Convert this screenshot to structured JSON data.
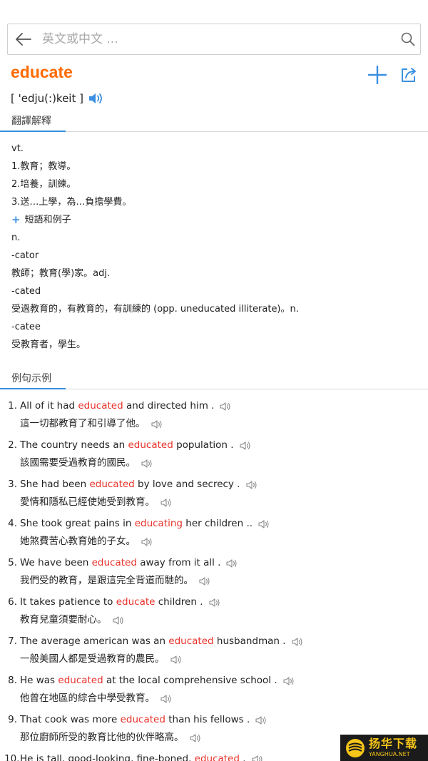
{
  "search": {
    "placeholder": "英文或中文 ..."
  },
  "word": {
    "headword": "educate",
    "phonetic": "[ 'edju(:)keit ]"
  },
  "sections": {
    "translation": "翻譯解釋",
    "examples": "例句示例"
  },
  "definitions": [
    "vt.",
    "1.教育；教導。",
    "2.培養，訓練。",
    "3.送…上學，為…負擔學費。",
    "n.",
    "-cator",
    "教師；教育(學)家。adj.",
    "-cated",
    "受過教育的，有教育的，有訓練的 (opp. uneducated illiterate)。n.",
    "-catee",
    "受教育者，學生。"
  ],
  "phrases_toggle": "短語和例子",
  "examples": [
    {
      "num": "1.",
      "pre": "All of it had ",
      "hl": "educated",
      "post": " and directed him .",
      "zh": "這一切都教育了和引導了他。"
    },
    {
      "num": "2.",
      "pre": "The country needs an ",
      "hl": "educated",
      "post": " population .",
      "zh": "該國需要受過教育的國民。"
    },
    {
      "num": "3.",
      "pre": "She had been ",
      "hl": "educated",
      "post": " by love and secrecy .",
      "zh": "愛情和隱私已經使她受到教育。"
    },
    {
      "num": "4.",
      "pre": "She took great pains in ",
      "hl": "educating",
      "post": " her children ..",
      "zh": "她煞費苦心教育她的子女。"
    },
    {
      "num": "5.",
      "pre": "We have been ",
      "hl": "educated",
      "post": " away from it all .",
      "zh": "我們受的教育，是跟這完全背道而馳的。"
    },
    {
      "num": "6.",
      "pre": "It takes patience to ",
      "hl": "educate",
      "post": " children .",
      "zh": "教育兒童須要耐心。"
    },
    {
      "num": "7.",
      "pre": "The average american was an ",
      "hl": "educated",
      "post": " husbandman .",
      "zh": "一般美國人都是受過教育的農民。"
    },
    {
      "num": "8.",
      "pre": "He was ",
      "hl": "educated",
      "post": " at the local comprehensive school .",
      "zh": "他曾在地區的綜合中學受教育。"
    },
    {
      "num": "9.",
      "pre": "That cook was more ",
      "hl": "educated",
      "post": " than his fellows .",
      "zh": "那位廚師所受的教育比他的伙伴略高。"
    },
    {
      "num": "10.",
      "pre": "He is tall, good-looking, fine-boned, ",
      "hl": "educated",
      "post": " .",
      "zh": ""
    }
  ],
  "watermark": {
    "cn": "扬华下载",
    "en": "YANGHUA.NET"
  },
  "colors": {
    "accent": "#3b8fe0",
    "headword": "#ff6a00",
    "highlight": "#e8322b"
  }
}
